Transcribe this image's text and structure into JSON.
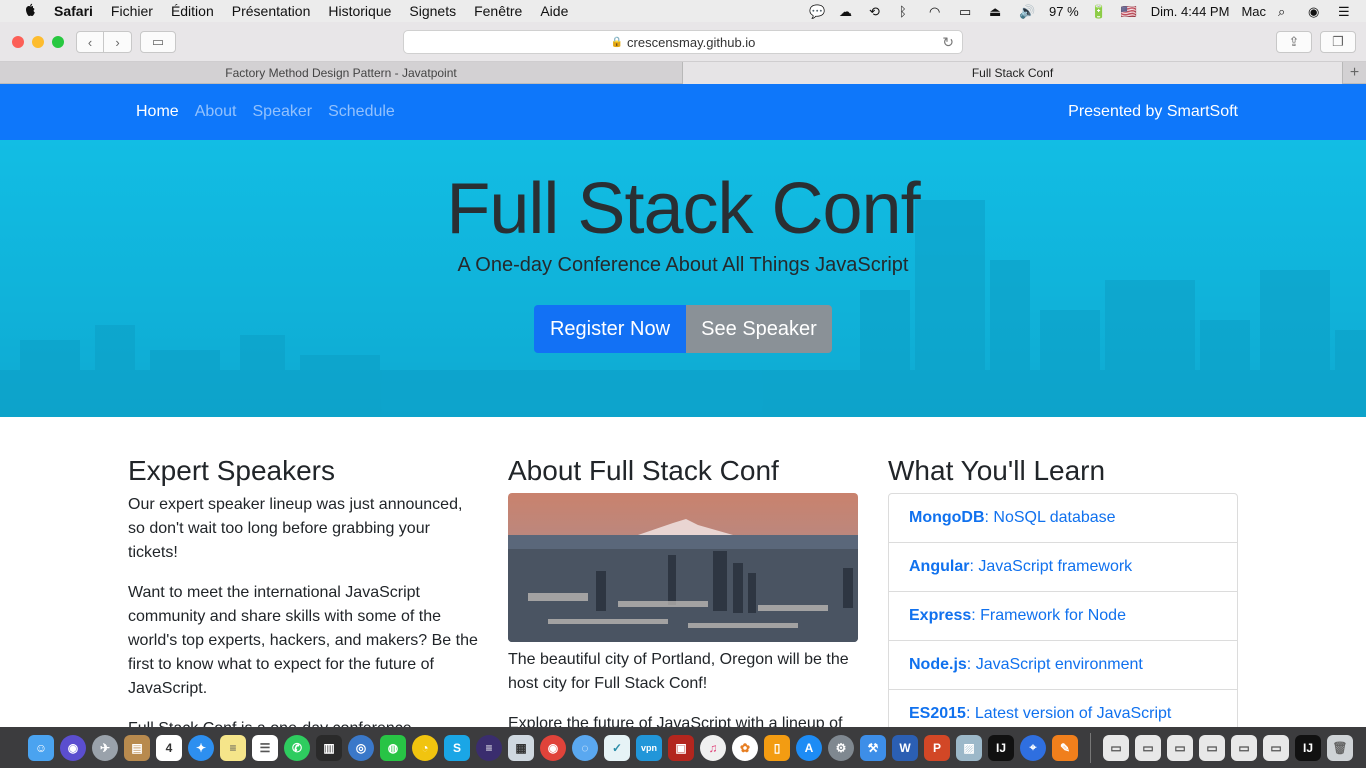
{
  "menubar": {
    "app": "Safari",
    "items": [
      "Fichier",
      "Édition",
      "Présentation",
      "Historique",
      "Signets",
      "Fenêtre",
      "Aide"
    ],
    "battery": "97 %",
    "clock": "Dim. 4:44 PM",
    "user": "Mac"
  },
  "browser": {
    "url": "crescensmay.github.io",
    "tabs": [
      {
        "title": "Factory Method Design Pattern - Javatpoint"
      },
      {
        "title": "Full Stack Conf"
      }
    ]
  },
  "site": {
    "nav": {
      "links": [
        "Home",
        "About",
        "Speaker",
        "Schedule"
      ],
      "presented_by": "Presented by SmartSoft"
    },
    "hero": {
      "title": "Full Stack Conf",
      "subtitle": "A One-day Conference About All Things JavaScript",
      "register_label": "Register Now",
      "speaker_label": "See Speaker"
    },
    "speakers": {
      "heading": "Expert Speakers",
      "p1": "Our expert speaker lineup was just announced, so don't wait too long before grabbing your tickets!",
      "p2": "Want to meet the international JavaScript community and share skills with some of the world's top experts, hackers, and makers? Be the first to know what to expect for the future of JavaScript.",
      "p3": "Full Stack Conf is a one-day conference dedicated to JavaScript and its ecosystem."
    },
    "about": {
      "heading": "About Full Stack Conf",
      "p1": "The beautiful city of Portland, Oregon will be the host city for Full Stack Conf!",
      "p2": "Explore the future of JavaScript with a lineup of industry professionals."
    },
    "learn": {
      "heading": "What You'll Learn",
      "items": [
        {
          "name": "MongoDB",
          "desc": ": NoSQL database"
        },
        {
          "name": "Angular",
          "desc": ": JavaScript framework"
        },
        {
          "name": "Express",
          "desc": ": Framework for Node"
        },
        {
          "name": "Node.js",
          "desc": ": JavaScript environment"
        },
        {
          "name": "ES2015",
          "desc": ": Latest version of JavaScript"
        }
      ]
    }
  },
  "colors": {
    "nav_bg": "#0e77fa",
    "hero_bg": "#12bde4",
    "primary": "#1271f5",
    "secondary": "#8a9197",
    "link": "#1071ee"
  },
  "dock": {
    "icons": [
      "finder-icon",
      "siri-icon",
      "launchpad-icon",
      "contacts-icon",
      "calendar-icon",
      "safari-icon",
      "notes-icon",
      "reminders-icon",
      "whatsapp-icon",
      "book-icon",
      "chrome-icon",
      "wechat-icon",
      "stocks-icon",
      "skype-icon",
      "eclipse-icon",
      "preview-icon",
      "chrome-icon-2",
      "messages-icon",
      "tool-icon",
      "vpn-icon",
      "photo-booth-icon",
      "itunes-icon",
      "photos-icon",
      "ibooks-icon",
      "app-store-icon",
      "system-preferences-icon",
      "xcode-icon",
      "word-icon",
      "powerpoint-icon",
      "preview-2-icon",
      "intellij-icon",
      "maps-icon",
      "pencil-icon",
      "document-1-icon",
      "document-2-icon",
      "document-3-icon",
      "document-4-icon",
      "document-5-icon",
      "document-6-icon",
      "intellij-2-icon",
      "trash-icon"
    ]
  }
}
